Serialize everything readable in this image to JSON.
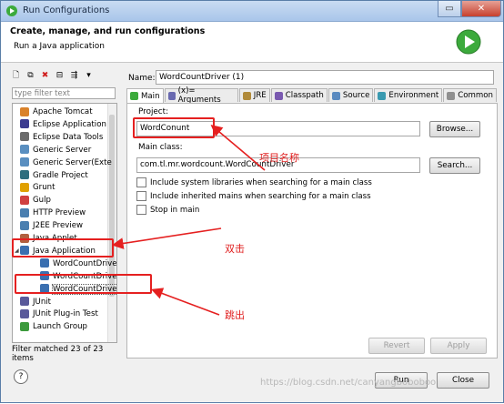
{
  "window": {
    "title": "Run Configurations"
  },
  "header": {
    "title": "Create, manage, and run configurations",
    "subtitle": "Run a Java application"
  },
  "left": {
    "filter_placeholder": "type filter text",
    "tree": [
      {
        "label": "Apache Tomcat",
        "icon": "tomcat-icon",
        "level": 1
      },
      {
        "label": "Eclipse Application",
        "icon": "eclipse-icon",
        "level": 1
      },
      {
        "label": "Eclipse Data Tools",
        "icon": "data-tools-icon",
        "level": 1
      },
      {
        "label": "Generic Server",
        "icon": "server-icon",
        "level": 1
      },
      {
        "label": "Generic Server(Exte",
        "icon": "server-icon",
        "level": 1
      },
      {
        "label": "Gradle Project",
        "icon": "gradle-icon",
        "level": 1
      },
      {
        "label": "Grunt",
        "icon": "grunt-icon",
        "level": 1
      },
      {
        "label": "Gulp",
        "icon": "gulp-icon",
        "level": 1
      },
      {
        "label": "HTTP Preview",
        "icon": "preview-icon",
        "level": 1
      },
      {
        "label": "J2EE Preview",
        "icon": "preview-icon",
        "level": 1
      },
      {
        "label": "Java Applet",
        "icon": "applet-icon",
        "level": 1
      },
      {
        "label": "Java Application",
        "icon": "java-app-icon",
        "level": 1,
        "expanded": true
      },
      {
        "label": "WordCountDrive",
        "icon": "java-config-icon",
        "level": 2
      },
      {
        "label": "WordCountDrive",
        "icon": "java-config-icon",
        "level": 2
      },
      {
        "label": "WordCountDriver (1)",
        "icon": "java-config-icon",
        "level": 2,
        "selected": true
      },
      {
        "label": "JUnit",
        "icon": "junit-icon",
        "level": 1
      },
      {
        "label": "JUnit Plug-in Test",
        "icon": "junit-plugin-icon",
        "level": 1
      },
      {
        "label": "Launch Group",
        "icon": "launch-group-icon",
        "level": 1
      }
    ],
    "filter_message": "Filter matched 23 of 23 items"
  },
  "form": {
    "name_label": "Name:",
    "name_value": "WordCountDriver (1)",
    "tabs": [
      {
        "label": "Main",
        "icon": "main-tab-icon",
        "active": true
      },
      {
        "label": "(x)= Arguments",
        "icon": "arguments-tab-icon"
      },
      {
        "label": "JRE",
        "icon": "jre-tab-icon"
      },
      {
        "label": "Classpath",
        "icon": "classpath-tab-icon"
      },
      {
        "label": "Source",
        "icon": "source-tab-icon"
      },
      {
        "label": "Environment",
        "icon": "environment-tab-icon"
      },
      {
        "label": "Common",
        "icon": "common-tab-icon"
      }
    ],
    "project_label": "Project:",
    "project_value": "WordConunt",
    "browse_label": "Browse...",
    "main_class_label": "Main class:",
    "main_class_value": "com.tl.mr.wordcount.WordCountDriver",
    "search_label": "Search...",
    "checkboxes": [
      {
        "label": "Include system libraries when searching for a main class",
        "checked": false
      },
      {
        "label": "Include inherited mains when searching for a main class",
        "checked": false
      },
      {
        "label": "Stop in main",
        "checked": false
      }
    ],
    "revert_label": "Revert",
    "apply_label": "Apply"
  },
  "footer": {
    "run_label": "Run",
    "close_label": "Close"
  },
  "annotations": {
    "project_name": "项目名称",
    "double_click": "双击",
    "pop_out": "跳出"
  },
  "watermark": "https://blog.csdn.net/canyangboboboo",
  "colors": {
    "accent_red": "#e52020",
    "run_green": "#3caa3c",
    "title_blue": "#a9c6ea"
  }
}
